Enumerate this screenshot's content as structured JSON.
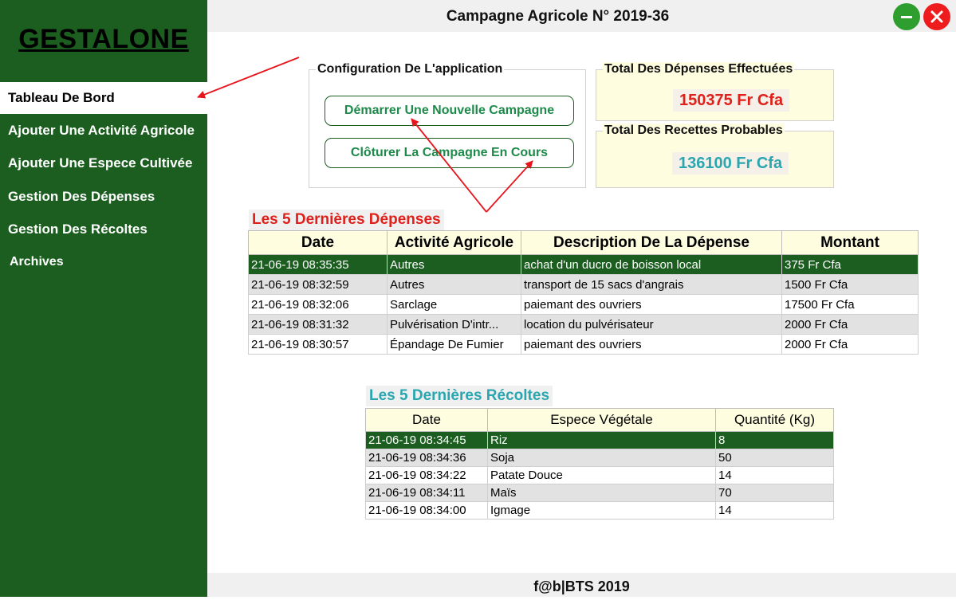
{
  "app": {
    "logo": "GESTALONE",
    "window_title": "Campagne Agricole N° 2019-36",
    "footer": "f@b|BTS 2019"
  },
  "sidebar": {
    "items": [
      {
        "label": "Tableau De Bord",
        "active": true
      },
      {
        "label": "Ajouter Une Activité Agricole",
        "active": false
      },
      {
        "label": "Ajouter Une Espece Cultivée",
        "active": false
      },
      {
        "label": "Gestion Des Dépenses",
        "active": false
      },
      {
        "label": "Gestion Des Récoltes",
        "active": false
      },
      {
        "label": "Archives",
        "active": false
      }
    ]
  },
  "window_controls": {
    "minimize": "minimize-icon",
    "close": "close-icon"
  },
  "config": {
    "legend": "Configuration De L'application",
    "start_label": "Démarrer Une Nouvelle Campagne",
    "close_label": "Clôturer La Campagne En Cours"
  },
  "totals": {
    "depenses": {
      "legend": "Total Des Dépenses Effectuées",
      "value": "150375 Fr Cfa",
      "color": "#e0201a"
    },
    "recettes": {
      "legend": "Total Des Recettes Probables",
      "value": "136100 Fr Cfa",
      "color": "#2aa6b0"
    }
  },
  "depenses": {
    "title": "Les 5 Dernières Dépenses",
    "columns": [
      "Date",
      "Activité Agricole",
      "Description De La Dépense",
      "Montant"
    ],
    "rows": [
      [
        "21-06-19 08:35:35",
        "Autres",
        "achat d'un ducro de boisson local",
        "375 Fr Cfa"
      ],
      [
        "21-06-19 08:32:59",
        "Autres",
        "transport de 15 sacs d'angrais",
        "1500 Fr Cfa"
      ],
      [
        "21-06-19 08:32:06",
        "Sarclage",
        "paiemant des ouvriers",
        "17500 Fr Cfa"
      ],
      [
        "21-06-19 08:31:32",
        "Pulvérisation D'intr...",
        "location du pulvérisateur",
        "2000 Fr Cfa"
      ],
      [
        "21-06-19 08:30:57",
        "Épandage De Fumier",
        "paiemant des ouvriers",
        "2000 Fr Cfa"
      ]
    ]
  },
  "recoltes": {
    "title": "Les 5 Dernières Récoltes",
    "columns": [
      "Date",
      "Espece Végétale",
      "Quantité (Kg)"
    ],
    "rows": [
      [
        "21-06-19 08:34:45",
        "Riz",
        "8"
      ],
      [
        "21-06-19 08:34:36",
        "Soja",
        "50"
      ],
      [
        "21-06-19 08:34:22",
        "Patate Douce",
        "14"
      ],
      [
        "21-06-19 08:34:11",
        "Maïs",
        "70"
      ],
      [
        "21-06-19 08:34:00",
        "Igmage",
        "14"
      ]
    ]
  },
  "colors": {
    "sidebar": "#1b5e20",
    "accent_red": "#e0201a",
    "accent_teal": "#2aa6b0",
    "header_fill": "#fffde0"
  }
}
